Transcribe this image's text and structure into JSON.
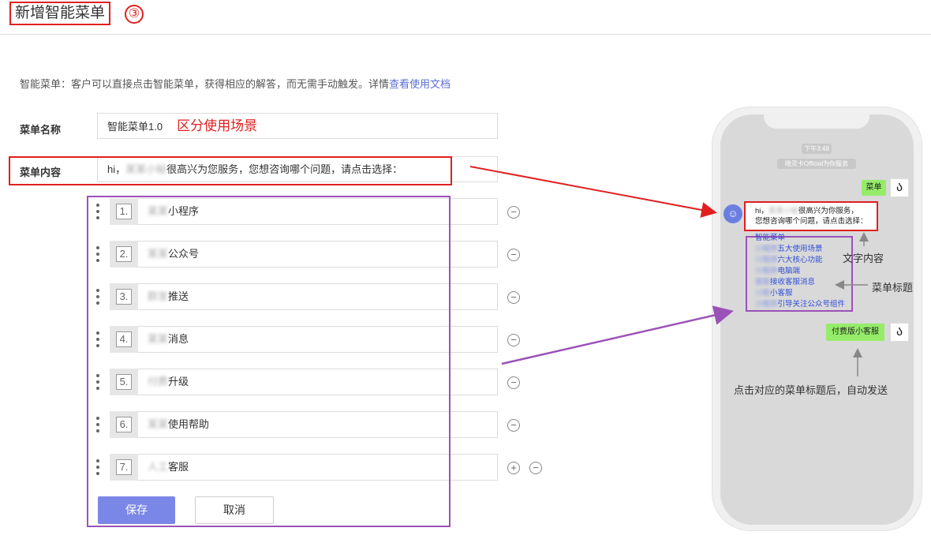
{
  "header": {
    "title": "新增智能菜单",
    "step": "③"
  },
  "description": {
    "text": "智能菜单：客户可以直接点击智能菜单，获得相应的解答，而无需手动触发。详情",
    "link": "查看使用文档"
  },
  "form": {
    "name_label": "菜单名称",
    "name_value": "智能菜单1.0",
    "name_note": "区分使用场景",
    "content_label": "菜单内容",
    "content_prefix": "hi，",
    "content_blur": "某某小秘",
    "content_rest": "很高兴为您服务，您想咨询哪个问题，请点击选择："
  },
  "menu_items": [
    {
      "num": "1.",
      "blur": "某某",
      "text": "小程序"
    },
    {
      "num": "2.",
      "blur": "某某",
      "text": "公众号"
    },
    {
      "num": "3.",
      "blur": "群发",
      "text": "推送"
    },
    {
      "num": "4.",
      "blur": "某某",
      "text": "消息"
    },
    {
      "num": "5.",
      "blur": "付费",
      "text": "升级"
    },
    {
      "num": "6.",
      "blur": "某某",
      "text": "使用帮助"
    },
    {
      "num": "7.",
      "blur": "人工",
      "text": "客服"
    }
  ],
  "row_buttons": {
    "remove": "−",
    "add": "+"
  },
  "buttons": {
    "save": "保存",
    "cancel": "取消"
  },
  "phone": {
    "time": "下午3:48",
    "official": "晓灵卡Official为你服务",
    "menu_bubble": "菜单",
    "msg_line1_prefix": "hi，",
    "msg_line1_blur": "某某小秘",
    "msg_line1_rest": "很高兴为你服务，",
    "msg_line2": "您想咨询哪个问题，请点击选择：",
    "list_header": "智能菜单",
    "list_items": [
      {
        "blur": "小程序",
        "text": "五大使用场景"
      },
      {
        "blur": "小程序",
        "text": "六大核心功能"
      },
      {
        "blur": "小程序",
        "text": "电脑端"
      },
      {
        "blur": "客服",
        "text": "接收客服消息"
      },
      {
        "blur": "小程",
        "text": "小客服"
      },
      {
        "blur": "小程序",
        "text": "引导关注公众号组件"
      }
    ],
    "paid_bubble": "付费版小客服"
  },
  "annotations": {
    "text_content": "文字内容",
    "menu_title": "菜单标题",
    "auto_send": "点击对应的菜单标题后，自动发送"
  },
  "colors": {
    "red": "#e02020",
    "purple": "#9b52b8",
    "primary": "#7b87e6",
    "link": "#5b6fd6"
  }
}
